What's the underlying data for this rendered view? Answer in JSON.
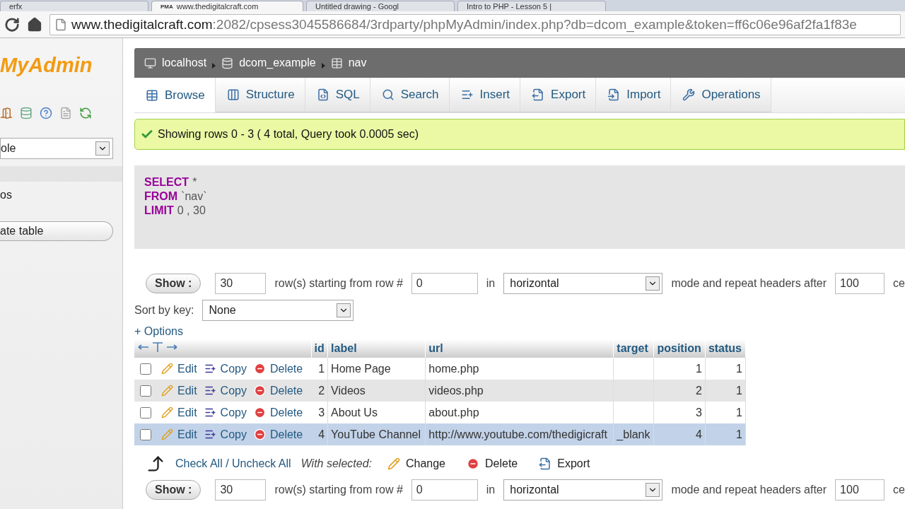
{
  "browser": {
    "tabs": [
      {
        "title": "erfx",
        "selected": false
      },
      {
        "title": "www.thedigitalcraft.com",
        "favicon": "PMA",
        "selected": true
      },
      {
        "title": "Untitled drawing - Googl",
        "selected": false
      },
      {
        "title": "Intro to PHP - Lesson 5 |",
        "selected": false
      }
    ],
    "address": {
      "host": "www.thedigitalcraft.com",
      "path": ":2082/cpsess3045586684/3rdparty/phpMyAdmin/index.php?db=dcom_example&token=ff6c06e96af2fa1f83e"
    }
  },
  "sidebar": {
    "logo": "MyAdmin",
    "table_select": "ole",
    "items": [
      {
        "label": "os"
      }
    ],
    "create_button": "ate table"
  },
  "breadcrumb": [
    {
      "label": "localhost",
      "kind": "server"
    },
    {
      "label": "dcom_example",
      "kind": "database"
    },
    {
      "label": "nav",
      "kind": "table"
    }
  ],
  "tabs": [
    {
      "label": "Browse",
      "selected": true
    },
    {
      "label": "Structure",
      "selected": false
    },
    {
      "label": "SQL",
      "selected": false
    },
    {
      "label": "Search",
      "selected": false
    },
    {
      "label": "Insert",
      "selected": false
    },
    {
      "label": "Export",
      "selected": false
    },
    {
      "label": "Import",
      "selected": false
    },
    {
      "label": "Operations",
      "selected": false
    }
  ],
  "message": "Showing rows 0 - 3 ( 4 total, Query took 0.0005 sec)",
  "sql": [
    {
      "keyword": "SELECT",
      "rest": "*"
    },
    {
      "keyword": "FROM",
      "rest": "`nav`"
    },
    {
      "keyword": "LIMIT",
      "rest": "0 , 30"
    }
  ],
  "navigation": [
    {
      "show_button": "Show :",
      "rows": "30",
      "starting_label": "row(s) starting from row #",
      "start": "0",
      "in_label": "in",
      "mode": "horizontal",
      "repeat_label": "mode and repeat headers after",
      "repeat": "100",
      "cells_label": "ce"
    }
  ],
  "sort": {
    "label": "Sort by key:",
    "value": "None"
  },
  "options_link": "+ Options",
  "table": {
    "columns": [
      "id",
      "label",
      "url",
      "target",
      "position",
      "status"
    ],
    "rows": [
      {
        "checked": false,
        "hovered": false,
        "actions": [
          "Edit",
          "Copy",
          "Delete"
        ],
        "cells": [
          "1",
          "Home Page",
          "home.php",
          "",
          "1",
          "1"
        ]
      },
      {
        "checked": false,
        "hovered": false,
        "actions": [
          "Edit",
          "Copy",
          "Delete"
        ],
        "cells": [
          "2",
          "Videos",
          "videos.php",
          "",
          "2",
          "1"
        ]
      },
      {
        "checked": false,
        "hovered": false,
        "actions": [
          "Edit",
          "Copy",
          "Delete"
        ],
        "cells": [
          "3",
          "About Us",
          "about.php",
          "",
          "3",
          "1"
        ]
      },
      {
        "checked": false,
        "hovered": true,
        "actions": [
          "Edit",
          "Copy",
          "Delete"
        ],
        "cells": [
          "4",
          "YouTube Channel",
          "http://www.youtube.com/thedigicraft",
          "_blank",
          "4",
          "1"
        ]
      }
    ]
  },
  "bulk": {
    "check_all": "Check All / Uncheck All",
    "with_selected": "With selected:",
    "actions": [
      "Change",
      "Delete",
      "Export"
    ]
  },
  "navigation_bottom": {
    "show_button": "Show :",
    "rows": "30",
    "starting_label": "row(s) starting from row #",
    "start": "0",
    "in_label": "in",
    "mode": "horizontal",
    "repeat_label": "mode and repeat headers after",
    "repeat": "100",
    "cells_label": "ce"
  }
}
